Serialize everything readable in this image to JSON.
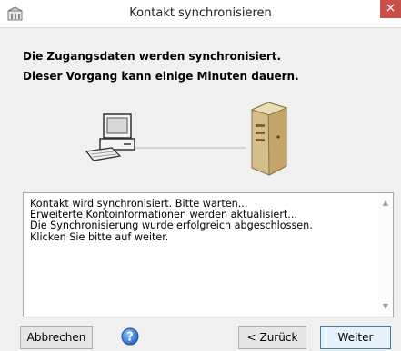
{
  "window": {
    "title": "Kontakt synchronisieren",
    "close_glyph": "×",
    "app_icon": "app-icon"
  },
  "header": {
    "line1": "Die Zugangsdaten werden synchronisiert.",
    "line2": "Dieser Vorgang kann einige Minuten dauern."
  },
  "illustration": {
    "left_icon": "computer-icon",
    "right_icon": "server-icon"
  },
  "log": {
    "lines": [
      "Kontakt wird synchronisiert. Bitte warten...",
      "Erweiterte Kontoinformationen werden aktualisiert...",
      "Die Synchronisierung wurde erfolgreich abgeschlossen.",
      "Klicken Sie bitte auf weiter."
    ]
  },
  "buttons": {
    "cancel": "Abbrechen",
    "back": "< Zurück",
    "next": "Weiter",
    "help_icon": "help-icon"
  }
}
